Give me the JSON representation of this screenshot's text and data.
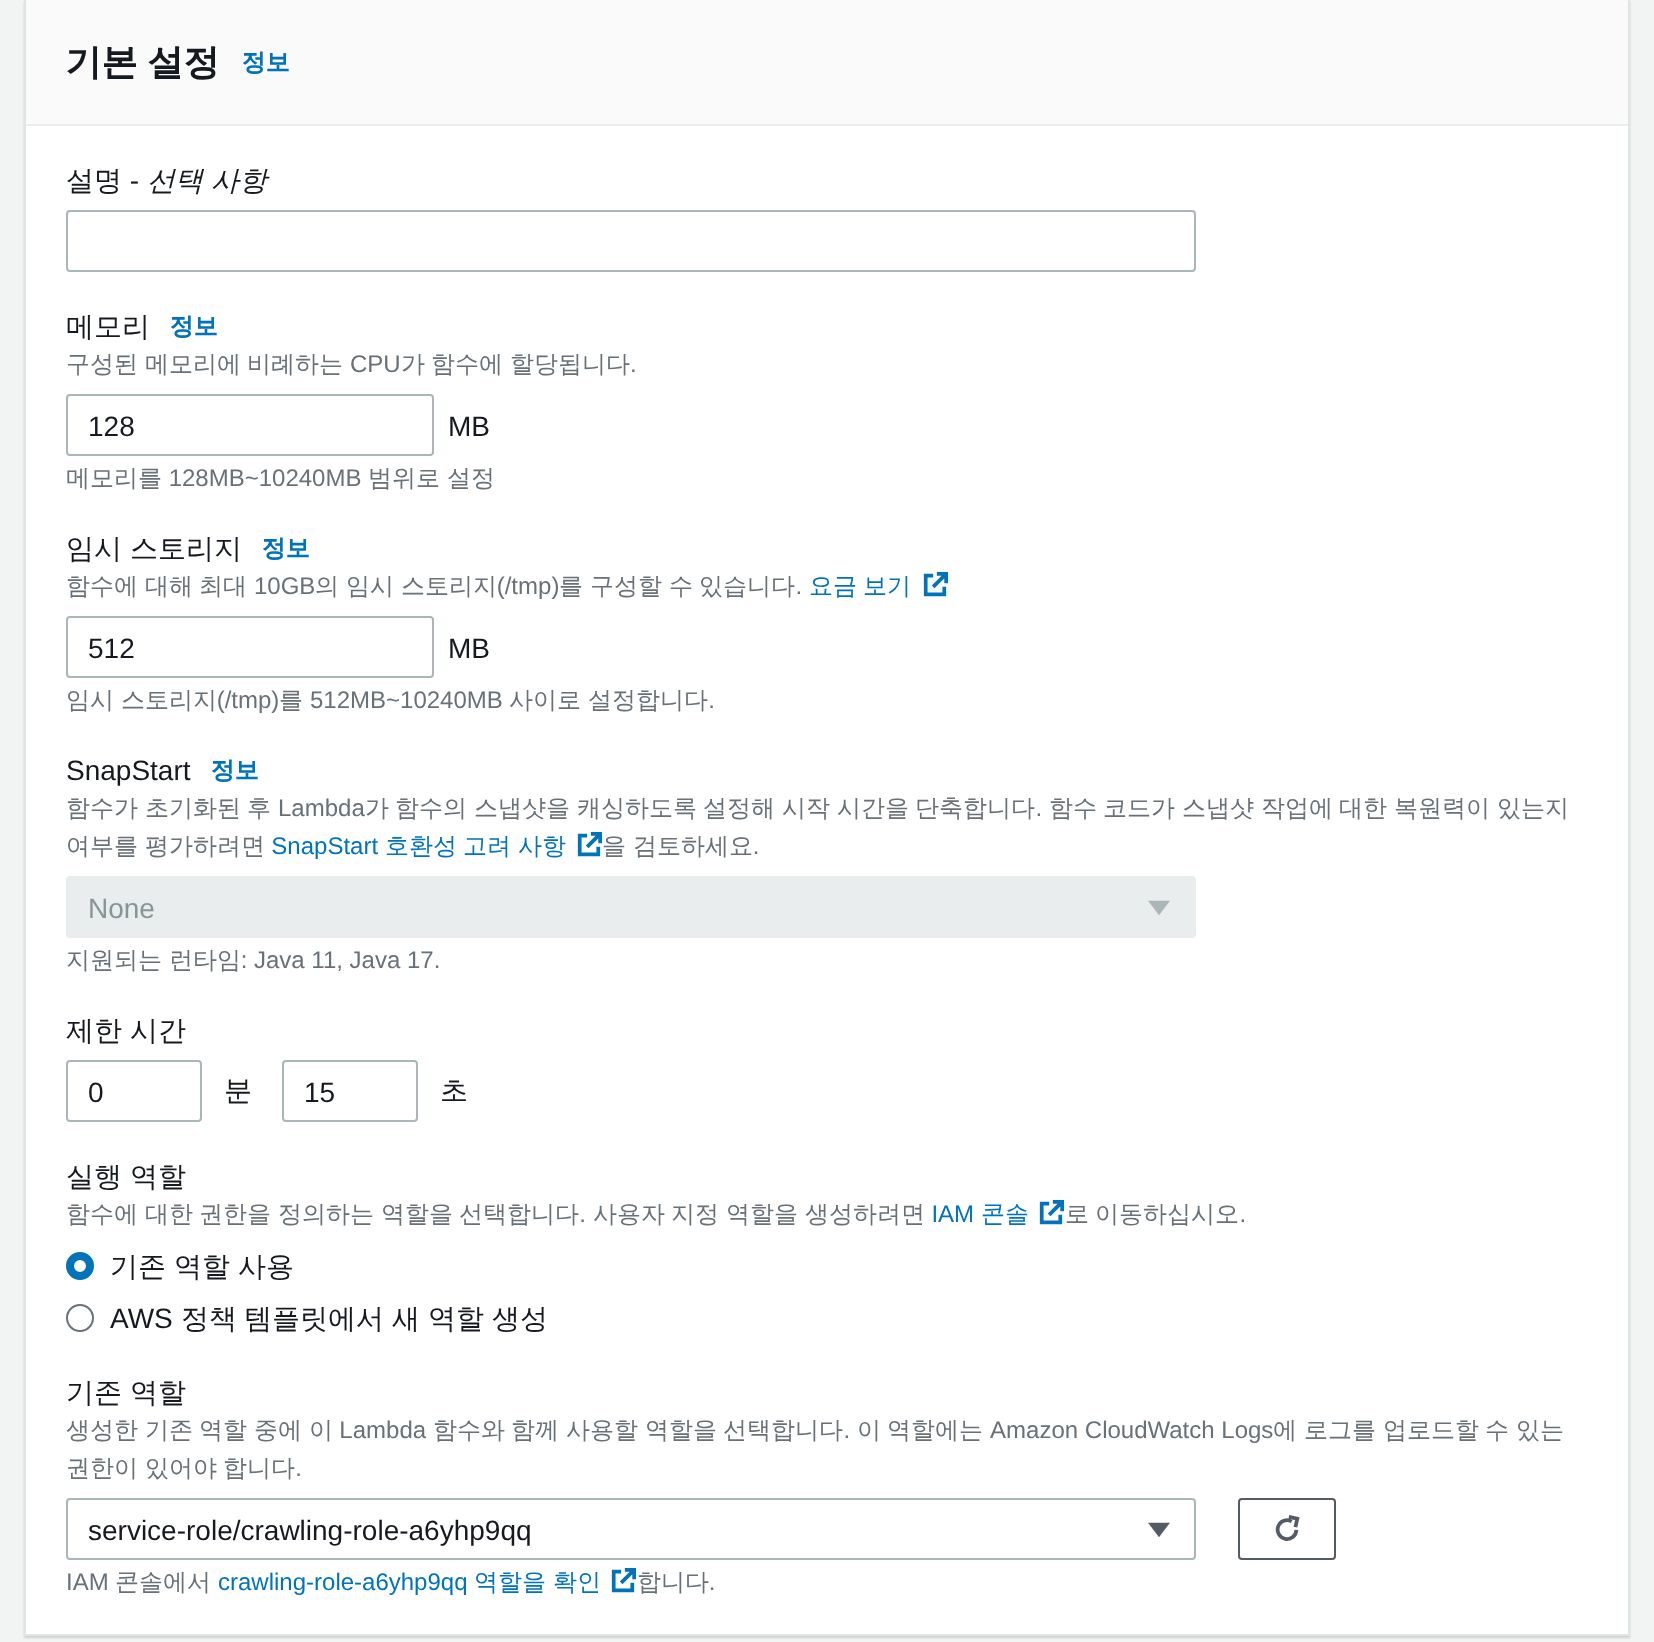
{
  "section": {
    "title": "기본 설정",
    "info_link": "정보"
  },
  "fields": [
    {
      "kind": "text",
      "label": "설명 - *선택 사항*"
    },
    {
      "kind": "number",
      "label": "메모리",
      "info_link": "정보",
      "description": [
        {
          "kind": "text",
          "text": "구성된 메모리에 비례하는 CPU가 함수에 할당됩니다."
        }
      ],
      "value": "128",
      "unit": "MB",
      "hint": [
        {
          "kind": "text",
          "text": "메모리를 128MB~10240MB 범위로 설정"
        }
      ]
    },
    {
      "kind": "number",
      "label": "임시 스토리지",
      "info_link": "정보",
      "description": [
        {
          "kind": "text",
          "text": "함수에 대해 최대 10GB의 임시 스토리지(/tmp)를 구성할 수 있습니다. "
        },
        {
          "kind": "external_link",
          "text": "요금 보기"
        }
      ],
      "value": "512",
      "unit": "MB",
      "hint": [
        {
          "kind": "text",
          "text": "임시 스토리지(/tmp)를 512MB~10240MB 사이로 설정합니다."
        }
      ]
    },
    {
      "kind": "select",
      "label": "SnapStart",
      "info_link": "정보",
      "description": [
        {
          "kind": "text",
          "text": "함수가 초기화된 후 Lambda가 함수의 스냅샷을 캐싱하도록 설정해 시작 시간을 단축합니다. 함수 코드가 스냅샷 작업에 대한 복원력이 있는지 여부를 평가하려면 "
        },
        {
          "kind": "external_link",
          "text": "SnapStart 호환성 고려 사항"
        },
        {
          "kind": "text",
          "text": "을 검토하세요."
        }
      ],
      "value": "None",
      "disabled": true,
      "hint": [
        {
          "kind": "text",
          "text": "지원되는 런타임: Java 11, Java 17."
        }
      ]
    },
    {
      "kind": "duration",
      "label": "제한 시간",
      "parts": [
        {
          "value": "0",
          "unit": "분"
        },
        {
          "value": "15",
          "unit": "초"
        }
      ]
    },
    {
      "kind": "radio",
      "label": "실행 역할",
      "description": [
        {
          "kind": "text",
          "text": "함수에 대한 권한을 정의하는 역할을 선택합니다. 사용자 지정 역할을 생성하려면 "
        },
        {
          "kind": "external_link",
          "text": "IAM 콘솔"
        },
        {
          "kind": "text",
          "text": "로 이동하십시오."
        }
      ],
      "options": [
        {
          "label": "기존 역할 사용",
          "selected": true
        },
        {
          "label": "AWS 정책 템플릿에서 새 역할 생성",
          "selected": false
        }
      ]
    },
    {
      "kind": "select",
      "label": "기존 역할",
      "description": [
        {
          "kind": "text",
          "text": "생성한 기존 역할 중에 이 Lambda 함수와 함께 사용할 역할을 선택합니다. 이 역할에는 Amazon CloudWatch Logs에 로그를 업로드할 수 있는 권한이 있어야 합니다."
        }
      ],
      "value": "service-role/crawling-role-a6yhp9qq",
      "disabled": false,
      "refresh": true,
      "hint": [
        {
          "kind": "text",
          "text": "IAM 콘솔에서 "
        },
        {
          "kind": "external_link",
          "text": "crawling-role-a6yhp9qq 역할을 확인"
        },
        {
          "kind": "text",
          "text": "합니다."
        }
      ]
    }
  ]
}
